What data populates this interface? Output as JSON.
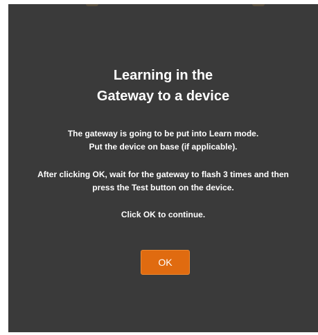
{
  "dialog": {
    "title_line1": "Learning in the",
    "title_line2": "Gateway to a device",
    "message1_line1": "The gateway is going to be put into Learn mode.",
    "message1_line2": "Put the device on base (if applicable).",
    "message2_line1": "After clicking OK, wait for the gateway to flash 3 times and then",
    "message2_line2": "press the Test button on the device.",
    "message3": "Click OK to continue.",
    "ok_label": "OK"
  },
  "colors": {
    "background": "#3a3a3a",
    "accent": "#e06b10",
    "text": "#ffffff"
  }
}
